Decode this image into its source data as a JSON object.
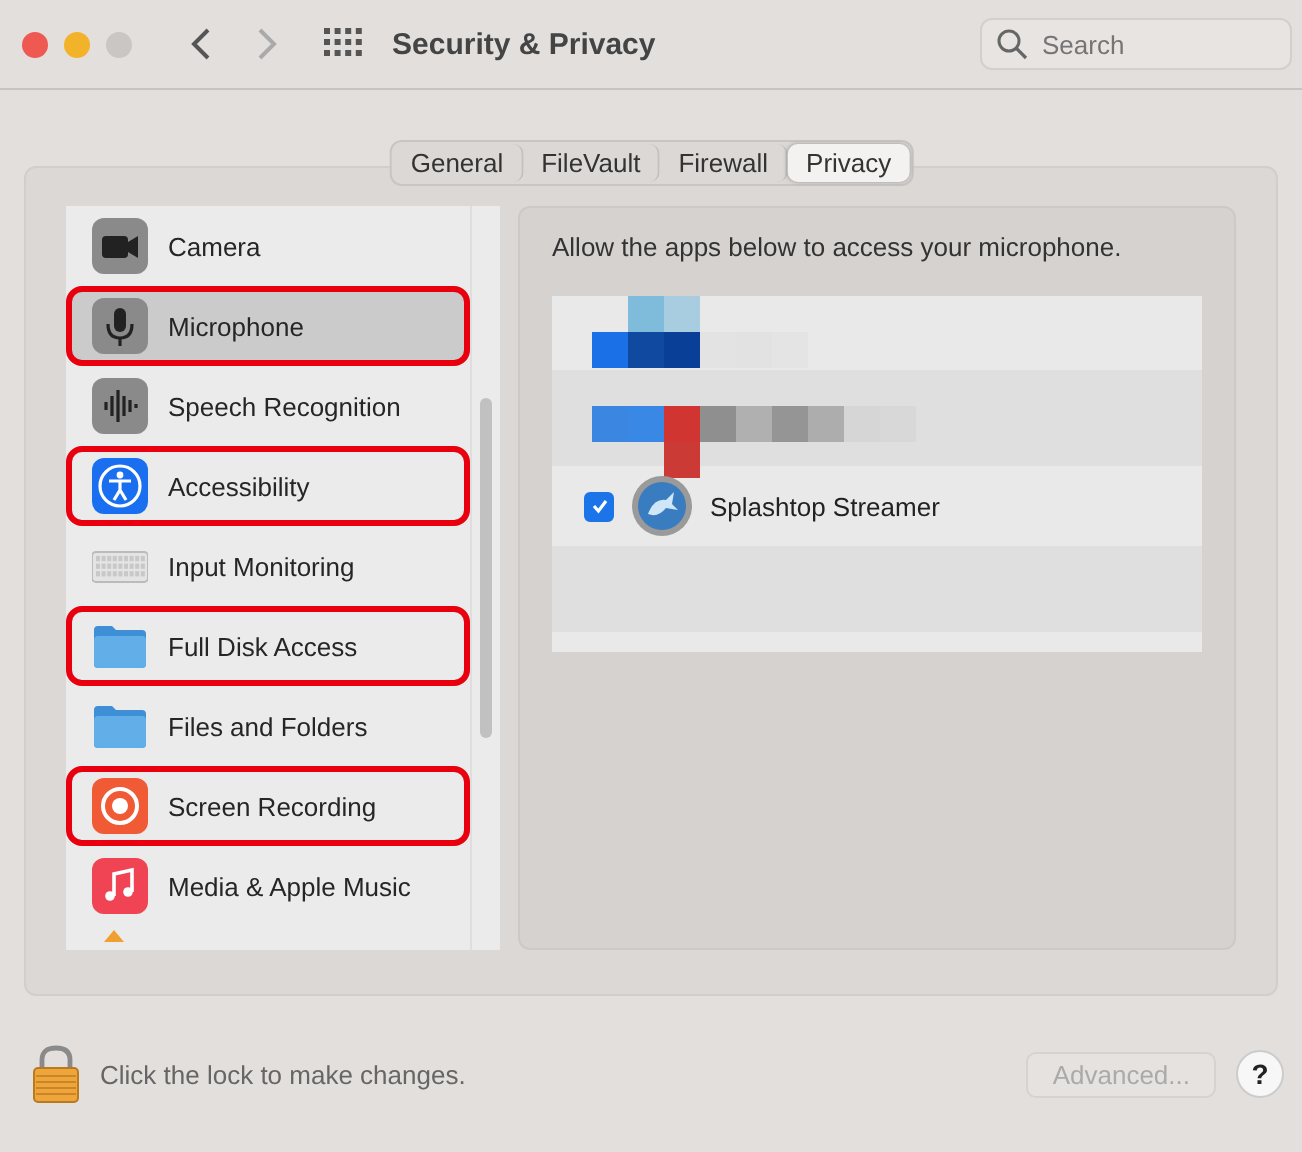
{
  "window": {
    "title": "Security & Privacy"
  },
  "search": {
    "placeholder": "Search"
  },
  "tabs": [
    {
      "label": "General",
      "selected": false
    },
    {
      "label": "FileVault",
      "selected": false
    },
    {
      "label": "Firewall",
      "selected": false
    },
    {
      "label": "Privacy",
      "selected": true
    }
  ],
  "sidebar": {
    "items": [
      {
        "label": "Camera",
        "kind": "camera",
        "selected": false,
        "highlighted": false
      },
      {
        "label": "Microphone",
        "kind": "microphone",
        "selected": true,
        "highlighted": true
      },
      {
        "label": "Speech Recognition",
        "kind": "speech",
        "selected": false,
        "highlighted": false
      },
      {
        "label": "Accessibility",
        "kind": "accessibility",
        "selected": false,
        "highlighted": true
      },
      {
        "label": "Input Monitoring",
        "kind": "keyboard",
        "selected": false,
        "highlighted": false
      },
      {
        "label": "Full Disk Access",
        "kind": "folder",
        "selected": false,
        "highlighted": true
      },
      {
        "label": "Files and Folders",
        "kind": "folder",
        "selected": false,
        "highlighted": false
      },
      {
        "label": "Screen Recording",
        "kind": "record",
        "selected": false,
        "highlighted": true
      },
      {
        "label": "Media & Apple Music",
        "kind": "music",
        "selected": false,
        "highlighted": false
      }
    ]
  },
  "detail": {
    "description": "Allow the apps below to access your microphone.",
    "apps": [
      {
        "kind": "pixelated"
      },
      {
        "kind": "pixelated"
      },
      {
        "kind": "app",
        "name": "Splashtop Streamer",
        "checked": true
      },
      {
        "kind": "empty"
      }
    ]
  },
  "footer": {
    "lock_text": "Click the lock to make changes.",
    "advanced_button": {
      "label": "Advanced...",
      "disabled": true
    },
    "help": "?"
  }
}
